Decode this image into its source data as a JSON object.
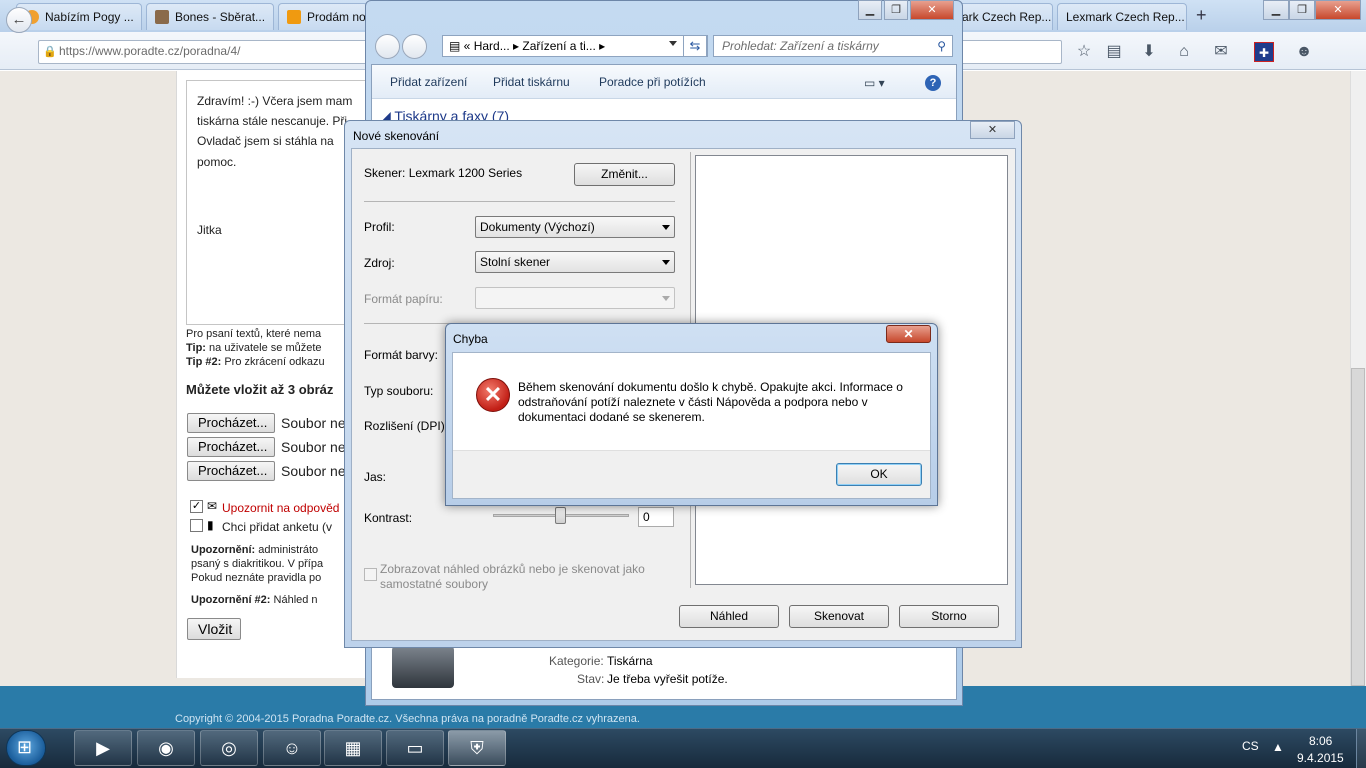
{
  "browser": {
    "tabs": [
      {
        "label": "Nabízím Pogy ...",
        "icon": "#f0a030"
      },
      {
        "label": "Bones - Sběrat...",
        "icon": "#8a6a4a"
      },
      {
        "label": "Prodám no",
        "icon": "#f09a10"
      },
      {
        "label": "ark Czech Rep...",
        "icon": "#e03030"
      },
      {
        "label": "Lexmark Czech Rep...",
        "icon": "#e03030"
      }
    ],
    "new_tab": "+",
    "url_host": "https://www.poradte.cz",
    "url_path": "/poradna/4/"
  },
  "page": {
    "text_lines": [
      "Zdravím! :-) Včera jsem mam",
      "tiskárna stále nescanuje. Při",
      "Ovladač jsem si stáhla na",
      "pomoc."
    ],
    "signature": "Jitka",
    "note1": "Pro psaní textů, které nema",
    "tip1_label": "Tip:",
    "tip1_text": " na uživatele se můžete",
    "tip2_label": "Tip #2:",
    "tip2_text": " Pro zkrácení odkazu",
    "images_heading": "Můžete vložit až 3 obráz",
    "browse_label": "Procházet...",
    "no_file": "Soubor ne",
    "notify_label": "Upozornit na odpověd",
    "poll_label": "Chci přidat anketu (v",
    "warning_label": "Upozornění:",
    "warning_lines": [
      " administráto",
      "psaný s diakritikou. V přípa",
      "Pokud neznáte pravidla po"
    ],
    "warning2_label": "Upozornění #2:",
    "warning2_text": " Náhled n",
    "submit": "Vložit",
    "footer": "Copyright © 2004-2015 Poradna Poradte.cz. Všechna práva na poradně Poradte.cz vyhrazena."
  },
  "explorer": {
    "breadcrumb": [
      "Hard...",
      "Zařízení a ti..."
    ],
    "search_placeholder": "Prohledat: Zařízení a tiskárny",
    "commands": [
      "Přidat zařízení",
      "Přidat tiskárnu",
      "Poradce při potížích"
    ],
    "group_title": "Tiskárny a faxy (7)",
    "details": {
      "category_label": "Kategorie:",
      "category_value": "Tiskárna",
      "state_label": "Stav:",
      "state_value": "Je třeba vyřešit potíže."
    }
  },
  "scan_dialog": {
    "title": "Nové skenování",
    "scanner_label": "Skener: Lexmark 1200 Series",
    "change_button": "Změnit...",
    "profile_label": "Profil:",
    "profile_value": "Dokumenty (Výchozí)",
    "source_label": "Zdroj:",
    "source_value": "Stolní skener",
    "paper_label": "Formát papíru:",
    "color_label": "Formát barvy:",
    "filetype_label": "Typ souboru:",
    "resolution_label": "Rozlišení (DPI):",
    "brightness_label": "Jas:",
    "contrast_label": "Kontrast:",
    "contrast_value": "0",
    "preview_checkbox": "Zobrazovat náhled obrázků nebo je skenovat jako samostatné soubory",
    "buttons": {
      "preview": "Náhled",
      "scan": "Skenovat",
      "cancel": "Storno"
    }
  },
  "error_dialog": {
    "title": "Chyba",
    "message": "Během skenování dokumentu došlo k chybě. Opakujte akci. Informace o odstraňování potíží naleznete v části Nápověda a podpora nebo v dokumentaci dodané se skenerem.",
    "ok": "OK",
    "icon": "error-x"
  },
  "taskbar": {
    "lang": "CS",
    "time": "8:06",
    "date": "9.4.2015"
  }
}
